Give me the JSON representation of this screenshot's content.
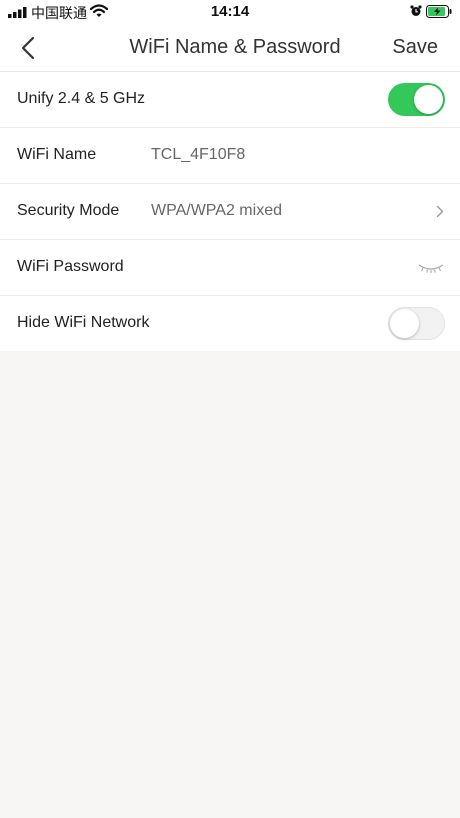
{
  "status_bar": {
    "carrier": "中国联通",
    "time": "14:14",
    "icons": [
      "signal-bars-icon",
      "wifi-icon",
      "alarm-icon",
      "battery-charging-icon"
    ]
  },
  "nav": {
    "title": "WiFi Name & Password",
    "save_label": "Save",
    "back_icon": "chevron-left-icon"
  },
  "settings": {
    "unify": {
      "label": "Unify 2.4 & 5 GHz",
      "enabled": true
    },
    "wifi_name": {
      "label": "WiFi Name",
      "value": "TCL_4F10F8"
    },
    "security_mode": {
      "label": "Security Mode",
      "value": "WPA/WPA2 mixed",
      "icon": "chevron-right-icon"
    },
    "wifi_password": {
      "label": "WiFi Password",
      "value": "",
      "icon": "eye-closed-icon"
    },
    "hide_network": {
      "label": "Hide WiFi Network",
      "enabled": false
    }
  },
  "colors": {
    "toggle_on": "#34c759",
    "background": "#f7f6f5"
  }
}
